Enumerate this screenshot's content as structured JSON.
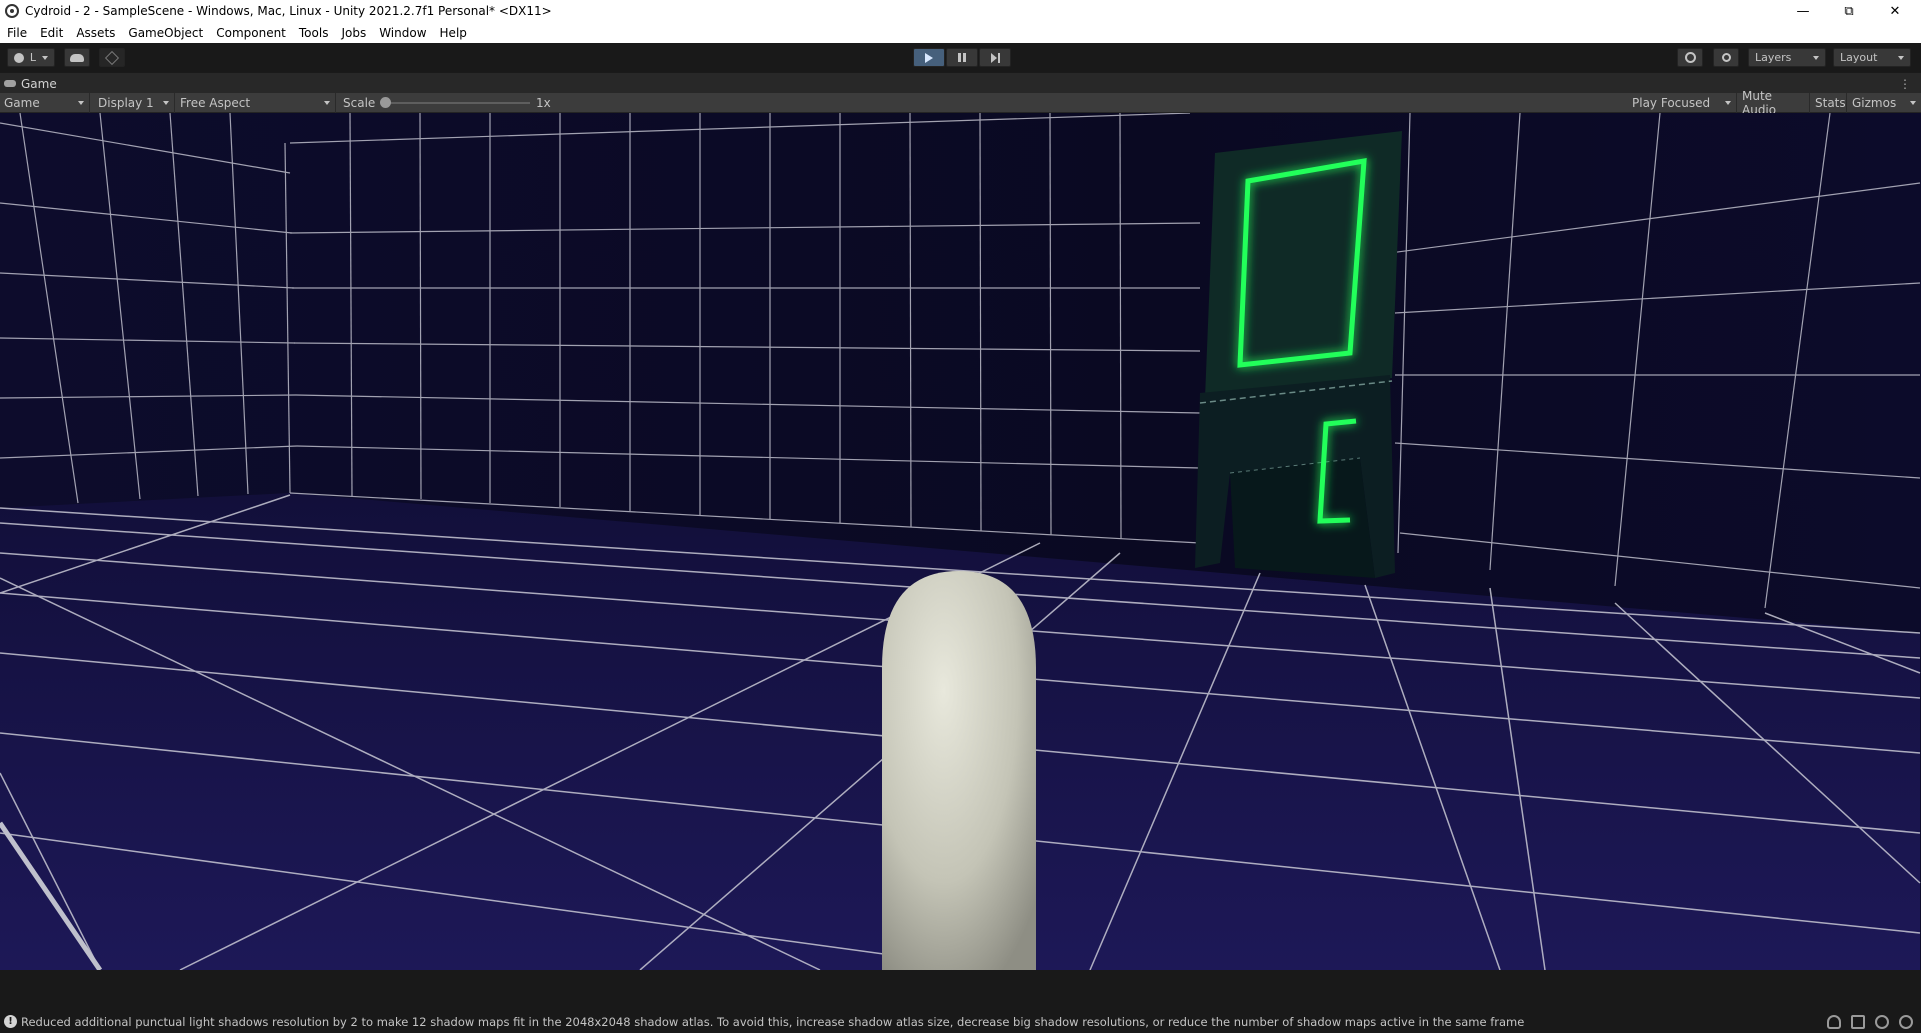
{
  "window": {
    "title": "Cydroid - 2 - SampleScene - Windows, Mac, Linux - Unity 2021.2.7f1 Personal* <DX11>",
    "minimize": "—",
    "maximize": "⧉",
    "close": "✕"
  },
  "menu": [
    "File",
    "Edit",
    "Assets",
    "GameObject",
    "Component",
    "Tools",
    "Jobs",
    "Window",
    "Help"
  ],
  "toolbar": {
    "account_label": "L",
    "layers_label": "Layers",
    "layout_label": "Layout"
  },
  "tab": {
    "label": "Game"
  },
  "gamebar": {
    "mode": "Game",
    "display": "Display 1",
    "aspect": "Free Aspect",
    "scale_label": "Scale",
    "scale_value": "1x",
    "play_focused": "Play Focused",
    "mute_audio": "Mute Audio",
    "stats": "Stats",
    "gizmos": "Gizmos"
  },
  "status": {
    "message": "Reduced additional punctual light shadows resolution by 2 to make 12 shadow maps fit in the 2048x2048 shadow atlas. To avoid this, increase shadow atlas size, decrease big shadow resolutions, or reduce the number of shadow maps active in the same frame"
  },
  "colors": {
    "neon": "#22ff5a",
    "grid": "#c8c8d4",
    "floor": "#1a1650",
    "wall": "#0b0a26"
  }
}
